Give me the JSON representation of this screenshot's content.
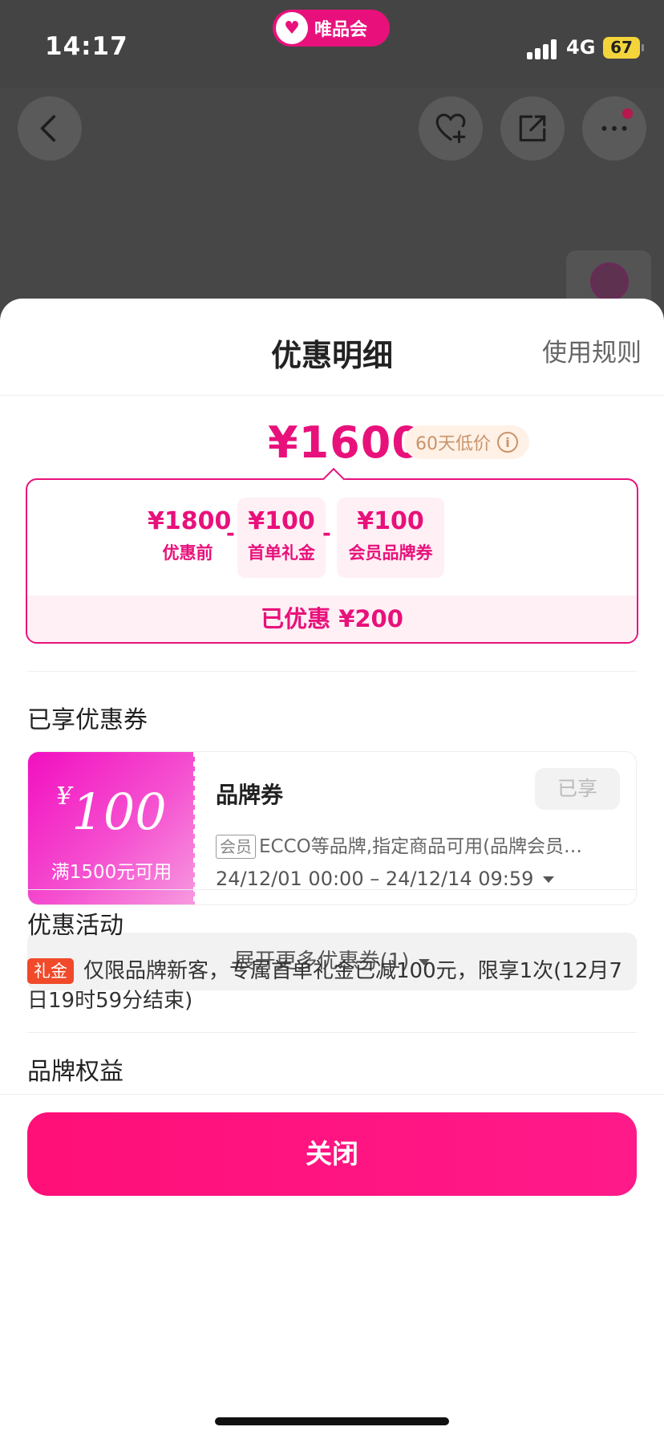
{
  "status_bar": {
    "time": "14:17",
    "network": "4G",
    "battery": "67",
    "app_badge": "唯品会"
  },
  "sheet": {
    "title": "优惠明细",
    "rules_link": "使用规则"
  },
  "price": {
    "final": "¥1600",
    "badge": "60天低价",
    "breakdown": [
      {
        "amount": "¥1800",
        "label": "优惠前"
      },
      {
        "amount": "¥100",
        "label": "首单礼金"
      },
      {
        "amount": "¥100",
        "label": "会员品牌券"
      }
    ],
    "operator": "-",
    "saved": "已优惠 ¥200"
  },
  "coupons": {
    "section_title": "已享优惠券",
    "items": [
      {
        "currency": "¥",
        "amount": "100",
        "condition": "满1500元可用",
        "name": "品牌券",
        "state": "已享",
        "tag": "会员",
        "desc": "ECCO等品牌,指定商品可用(品牌会员…",
        "period": "24/12/01 00:00 – 24/12/14 09:59"
      }
    ],
    "expand_label": "展开更多优惠券(1)"
  },
  "activities": {
    "section_title": "优惠活动",
    "items": [
      {
        "tag": "礼金",
        "text": "仅限品牌新客，专属首单礼金已减100元，限享1次(12月7日19时59分结束)"
      }
    ]
  },
  "brand_benefits": {
    "section_title": "品牌权益"
  },
  "footer": {
    "close_label": "关闭"
  },
  "colors": {
    "accent": "#e8117b",
    "gift_tag": "#f04a2a",
    "low_price_text": "#c9936a"
  }
}
